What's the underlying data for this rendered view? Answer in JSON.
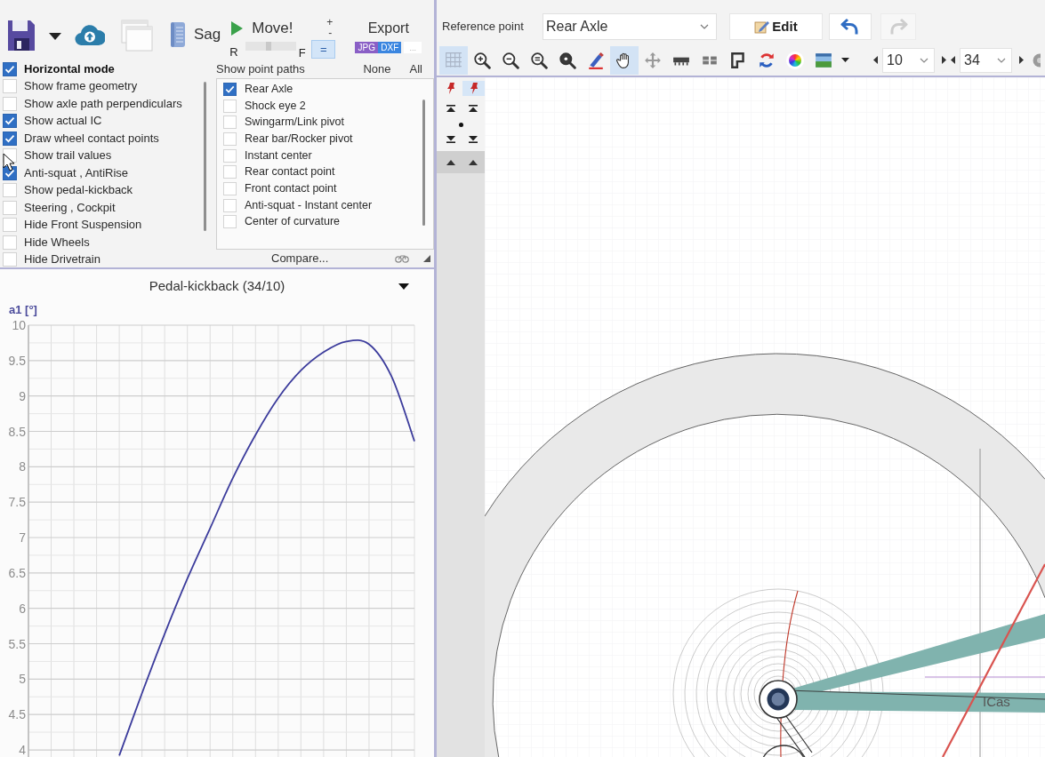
{
  "file_toolbar": {
    "sag": "Sag",
    "move": {
      "label": "Move!",
      "rear": "R",
      "front": "F",
      "level": 0.45
    },
    "step": {
      "plus": "+",
      "minus": "-",
      "equal": "="
    },
    "export": {
      "label": "Export",
      "formats": [
        {
          "label": "JPG",
          "color": "#8a5fc6"
        },
        {
          "label": "DXF",
          "color": "#3b86e0"
        }
      ],
      "more": "..."
    }
  },
  "display_options": {
    "main": {
      "label": "Horizontal mode",
      "checked": true
    },
    "items": [
      {
        "label": "Show frame geometry",
        "checked": false
      },
      {
        "label": "Show axle path perpendiculars",
        "checked": false
      },
      {
        "label": "Show actual IC",
        "checked": true
      },
      {
        "label": "Draw wheel contact points",
        "checked": true
      },
      {
        "label": "Show trail values",
        "checked": false
      },
      {
        "label": "Anti-squat , AntiRise",
        "checked": true
      },
      {
        "label": "Show pedal-kickback",
        "checked": false
      },
      {
        "label": "Steering , Cockpit",
        "checked": false
      },
      {
        "label": "Hide Front Suspension",
        "checked": false
      },
      {
        "label": "Hide Wheels",
        "checked": false
      },
      {
        "label": "Hide Drivetrain",
        "checked": false
      }
    ]
  },
  "point_paths": {
    "title": "Show point paths",
    "none": "None",
    "all": "All",
    "items": [
      {
        "label": "Rear Axle",
        "checked": true
      },
      {
        "label": "Shock eye 2",
        "checked": false
      },
      {
        "label": "Swingarm/Link pivot",
        "checked": false
      },
      {
        "label": "Rear bar/Rocker pivot",
        "checked": false
      },
      {
        "label": "Instant center",
        "checked": false
      },
      {
        "label": "Rear contact point",
        "checked": false
      },
      {
        "label": "Front contact point",
        "checked": false
      },
      {
        "label": "Anti-squat - Instant center",
        "checked": false
      },
      {
        "label": "Center of curvature",
        "checked": false
      }
    ],
    "compare": "Compare..."
  },
  "chart_panel": {
    "chart_data": {
      "type": "line",
      "title": "Pedal-kickback (34/10)",
      "ylabel": "a1 [°]",
      "categories": [
        null,
        null,
        null,
        null,
        null,
        null,
        null,
        null,
        null,
        null,
        null,
        null,
        null,
        null,
        null,
        null,
        null,
        null
      ],
      "series": [
        {
          "color": "#3c3c9c",
          "values": [
            null,
            null,
            null,
            null,
            3.92,
            4.8,
            5.64,
            6.42,
            7.13,
            7.84,
            8.45,
            8.97,
            9.36,
            9.62,
            9.77,
            9.73,
            9.27,
            8.36
          ]
        }
      ],
      "ylim": [
        3.9,
        10
      ],
      "yticks": [
        4,
        4.5,
        5,
        5.5,
        6,
        6.5,
        7,
        7.5,
        8,
        8.5,
        9,
        9.5,
        10
      ],
      "grid": true
    }
  },
  "reference_toolbar": {
    "label": "Reference point",
    "value": "Rear Axle",
    "edit": "Edit",
    "undo": {
      "disabled": false
    },
    "redo": {
      "disabled": true
    }
  },
  "view_tools": [
    {
      "selected": true
    },
    {
      "selected": false
    },
    {
      "selected": false
    },
    {
      "selected": false
    },
    {
      "selected": false
    },
    {
      "selected": false
    },
    {
      "selected": true
    },
    {
      "selected": false
    },
    {
      "selected": false
    },
    {
      "selected": false
    },
    {
      "selected": false
    },
    {
      "selected": false
    },
    {
      "selected": false
    },
    {
      "selected": false
    }
  ],
  "spinners": [
    {
      "value": "10"
    },
    {
      "value": "34"
    }
  ],
  "canvas": {
    "pins": [
      {
        "selected": false
      },
      {
        "selected": true
      }
    ],
    "label": "ICas"
  }
}
